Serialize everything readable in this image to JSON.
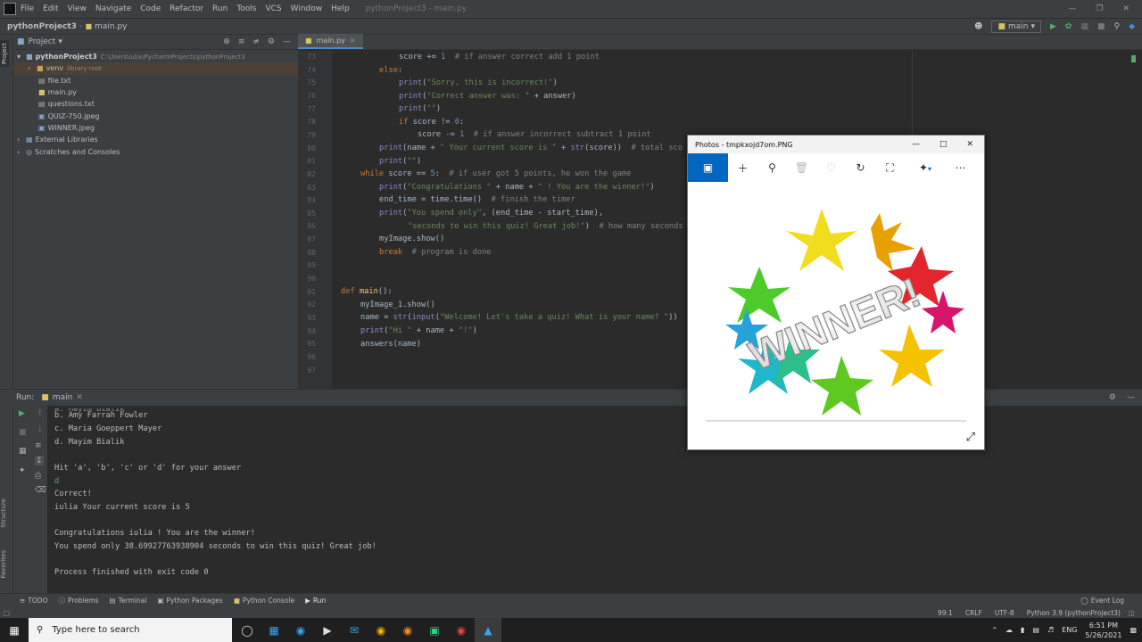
{
  "menubar": {
    "items": [
      "File",
      "Edit",
      "View",
      "Navigate",
      "Code",
      "Refactor",
      "Run",
      "Tools",
      "VCS",
      "Window",
      "Help"
    ],
    "window_title": "pythonProject3 - main.py"
  },
  "navbar": {
    "project": "pythonProject3",
    "file": "main.py",
    "run_config": "main"
  },
  "project_panel": {
    "title": "Project",
    "root_name": "pythonProject3",
    "root_path": "C:\\Users\\iulia\\PycharmProjects\\pythonProject3",
    "venv": "venv",
    "venv_note": "library root",
    "files": [
      "file.txt",
      "main.py",
      "questions.txt",
      "QUIZ-750.jpeg",
      "WINNER.jpeg"
    ],
    "external": "External Libraries",
    "scratches": "Scratches and Consoles"
  },
  "editor": {
    "tab": "main.py",
    "line_numbers": [
      "73",
      "74",
      "75",
      "76",
      "77",
      "78",
      "79",
      "80",
      "81",
      "82",
      "83",
      "84",
      "85",
      "86",
      "87",
      "88",
      "89",
      "90",
      "91",
      "92",
      "93",
      "94",
      "95",
      "96",
      "97"
    ]
  },
  "run_panel": {
    "label": "Run:",
    "config": "main",
    "output": [
      "b. Amy Farrah Fowler",
      "c. Maria Goeppert Mayer",
      "d. Mayim Bialik",
      "",
      "Hit 'a', 'b', 'c' or 'd' for your answer",
      "d",
      "Correct!",
      "iulia Your current score is 5",
      "",
      "Congratulations iulia ! You are the winner!",
      "You spend only 38.69927763938904 seconds to win this quiz! Great job!",
      "",
      "Process finished with exit code 0"
    ]
  },
  "bottom_tabs": [
    "TODO",
    "Problems",
    "Terminal",
    "Python Packages",
    "Python Console",
    "Run"
  ],
  "event_log": "Event Log",
  "statusbar": {
    "position": "99:1",
    "line_sep": "CRLF",
    "encoding": "UTF-8",
    "interpreter": "Python 3.9 (pythonProject3)"
  },
  "photos": {
    "title": "Photos - tmpkxojd7om.PNG",
    "image_text": "WINNER!"
  },
  "side_labels": {
    "project": "Project",
    "structure": "Structure",
    "favorites": "Favorites"
  },
  "taskbar": {
    "search_placeholder": "Type here to search",
    "lang": "ENG",
    "time": "6:51 PM",
    "date": "5/26/2021"
  }
}
